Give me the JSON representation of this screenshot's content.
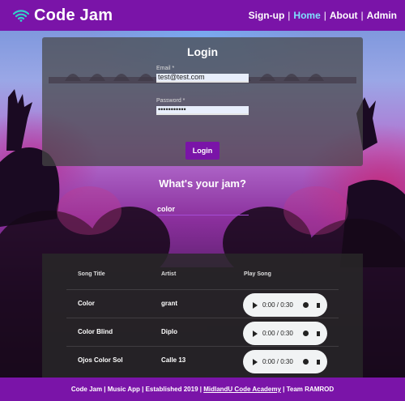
{
  "header": {
    "brand_title": "Code Jam",
    "nav": [
      {
        "label": "Sign-up"
      },
      {
        "label": "Home",
        "active": true
      },
      {
        "label": "About"
      },
      {
        "label": "Admin"
      }
    ]
  },
  "login": {
    "title": "Login",
    "email_label": "Email *",
    "email_value": "test@test.com",
    "password_label": "Password *",
    "password_value": "•••••••••••",
    "button_label": "Login"
  },
  "jam": {
    "title": "What's your jam?",
    "search_value": "color"
  },
  "table": {
    "headers": [
      "Song Title",
      "Artist",
      "Play Song"
    ],
    "rows": [
      {
        "title": "Color",
        "artist": "grant",
        "time": "0:00 / 0:30"
      },
      {
        "title": "Color Blind",
        "artist": "Diplo",
        "time": "0:00 / 0:30"
      },
      {
        "title": "Ojos Color Sol",
        "artist": "Calle 13",
        "time": "0:00 / 0:30"
      }
    ]
  },
  "footer": {
    "text_prefix": "Code Jam | Music App | Established 2019 | ",
    "link": "MidlandU Code Academy",
    "text_suffix": " | Team RAMROD"
  },
  "colors": {
    "brand_purple": "#7a14a8",
    "active_nav": "#7fe0ff"
  },
  "icons": {
    "logo": "wifi-signal-icon",
    "play": "play-icon",
    "volume": "volume-icon"
  }
}
